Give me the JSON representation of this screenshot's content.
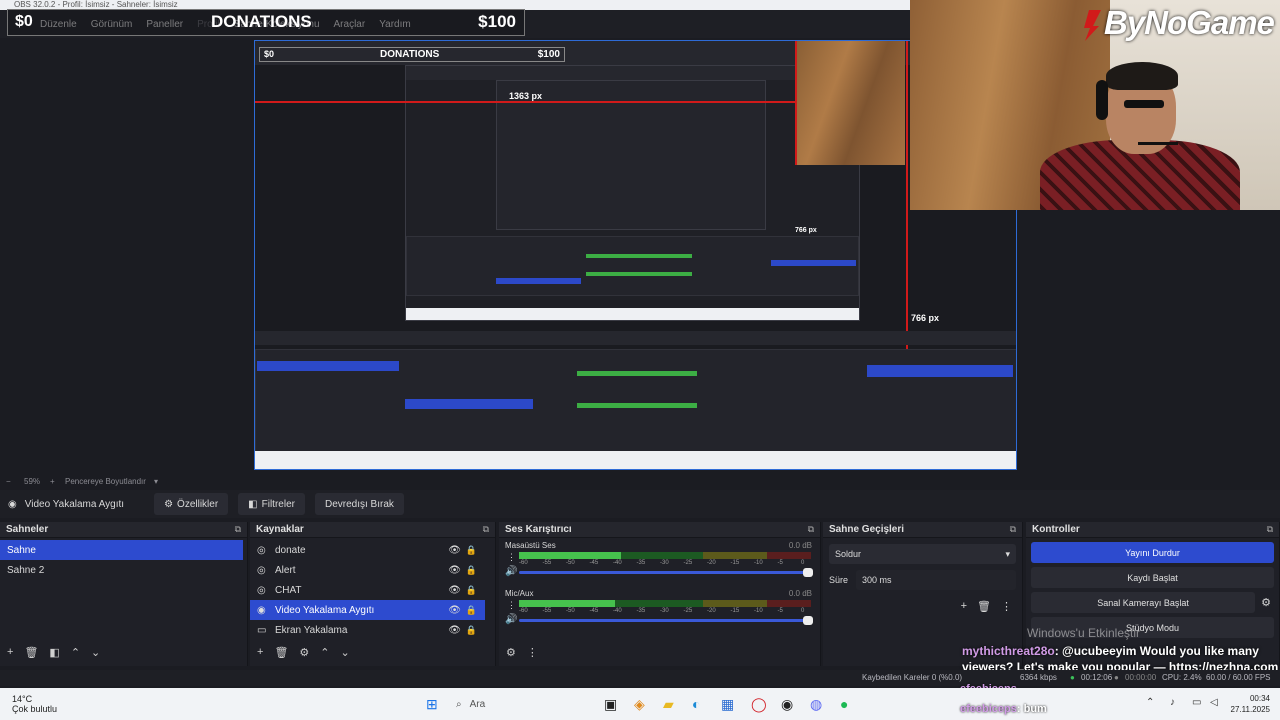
{
  "window": {
    "title": "OBS 32.0.2 - Profil: İsimsiz - Sahneler: İsimsiz"
  },
  "menu": {
    "items": [
      "Düzenle",
      "Görünüm",
      "Paneller",
      "Profil",
      "Sahne Koleksiyonu",
      "Araçlar",
      "Yardım"
    ],
    "disabled": [
      "Profil"
    ]
  },
  "donation_overlay": {
    "left_amount": "$0",
    "title": "DONATIONS",
    "right_amount": "$100"
  },
  "branding": {
    "logo_text": "ByNoGame"
  },
  "preview": {
    "inner_labels": {
      "width_px": "1363 px",
      "height_px": "766 px",
      "height_px_nested": "766 px"
    },
    "nested_title": "DONATIONS",
    "nested_left_amount": "$0",
    "nested_right_amount": "$100"
  },
  "zoom": {
    "level": "59%",
    "fit_label": "Pencereye Boyutlandır"
  },
  "source_toolbar": {
    "selected_source": "Video Yakalama Aygıtı",
    "properties": "Özellikler",
    "filters": "Filtreler",
    "deactivate": "Devredışı Bırak"
  },
  "scenes": {
    "title": "Sahneler",
    "items": [
      {
        "label": "Sahne",
        "selected": true
      },
      {
        "label": "Sahne 2",
        "selected": false
      }
    ]
  },
  "sources": {
    "title": "Kaynaklar",
    "items": [
      {
        "label": "donate",
        "icon": "globe-icon",
        "glyph": "◎",
        "selected": false
      },
      {
        "label": "Alert",
        "icon": "globe-icon",
        "glyph": "◎",
        "selected": false
      },
      {
        "label": "CHAT",
        "icon": "globe-icon",
        "glyph": "◎",
        "selected": false
      },
      {
        "label": "Video Yakalama Aygıtı",
        "icon": "camera-icon",
        "glyph": "◉",
        "selected": true
      },
      {
        "label": "Ekran Yakalama",
        "icon": "monitor-icon",
        "glyph": "▭",
        "selected": false
      }
    ]
  },
  "mixer": {
    "title": "Ses Karıştırıcı",
    "tracks": [
      {
        "name": "Masaüstü Ses",
        "db": "0.0 dB",
        "level": 0.35
      },
      {
        "name": "Mic/Aux",
        "db": "0.0 dB",
        "level": 0.33
      }
    ],
    "scale": [
      "-60",
      "-55",
      "-50",
      "-45",
      "-40",
      "-35",
      "-30",
      "-25",
      "-20",
      "-15",
      "-10",
      "-5",
      "0"
    ]
  },
  "transitions": {
    "title": "Sahne Geçişleri",
    "selected": "Soldur",
    "duration_label": "Süre",
    "duration_value": "300 ms"
  },
  "controls": {
    "title": "Kontroller",
    "stop_stream": "Yayını Durdur",
    "start_record": "Kaydı Başlat",
    "virtual_cam": "Sanal Kamerayı Başlat",
    "studio_mode": "Stüdyo Modu"
  },
  "watermark": "Windows'u Etkinleştir",
  "chat_overlay": {
    "user": "mythicthreat28o",
    "message": ": @ucubeeyim Would you like many viewers? Let's make you popular — https://nezhna.com",
    "user2": "efeebiceps",
    "message2": "",
    "user3": "efeebiceps",
    "message3": ": bum"
  },
  "status": {
    "dropped_frames": "Kaybedilen Kareler 0 (%0.0)",
    "bitrate": "6364 kbps",
    "stream_time": "00:12:06",
    "record_time": "00:00:00",
    "cpu": "CPU: 2.4%",
    "fps": "60.00 / 60.00 FPS"
  },
  "taskbar": {
    "weather_temp": "14°C",
    "weather_desc": "Çok bulutlu",
    "search": "Ara",
    "time": "00:34",
    "date": "27.11.2025"
  },
  "colors": {
    "accent": "#2d4bcf",
    "meter_green": "#46c24d",
    "red_guide": "#d11a1a"
  }
}
